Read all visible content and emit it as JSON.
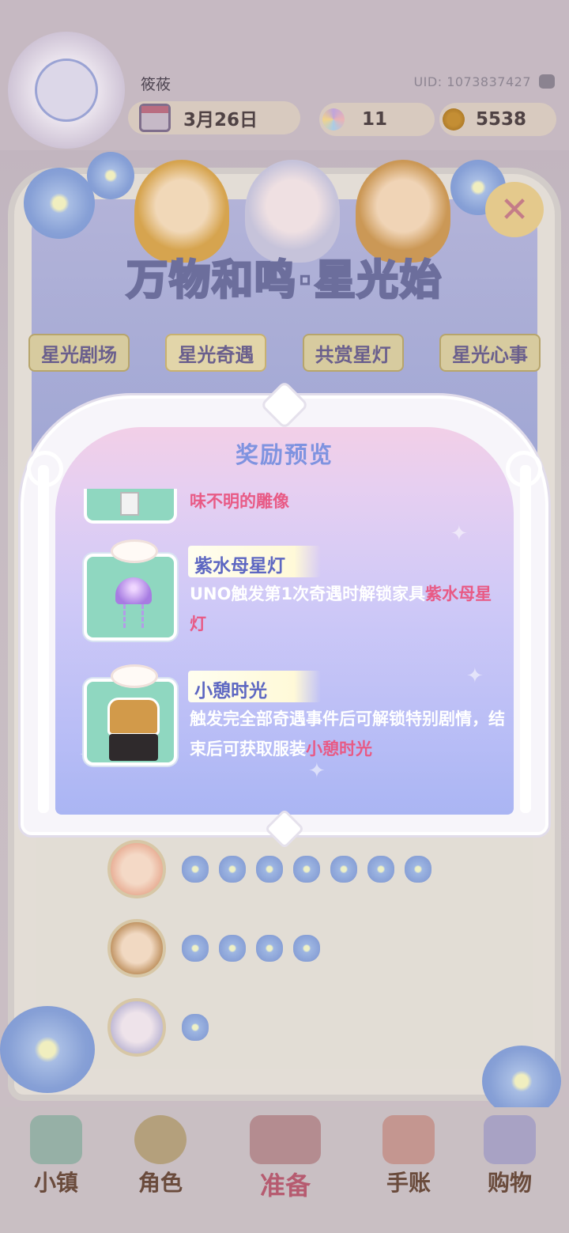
{
  "header": {
    "username": "筱莜",
    "uid": "UID: 1073837427",
    "date": "3月26日",
    "gems": "11",
    "coins": "5538"
  },
  "event": {
    "title": "万物和鸣·星光始",
    "tabs": [
      {
        "label": "星光剧场"
      },
      {
        "label": "星光奇遇"
      },
      {
        "label": "共赏星灯"
      },
      {
        "label": "星光心事"
      }
    ],
    "active_tab": "星光奇遇"
  },
  "modal": {
    "title": "奖励预览",
    "partial_item_text": "味不明的雕像",
    "rewards": [
      {
        "name": "紫水母星灯",
        "desc_plain": "UNO触发第1次奇遇时解锁家具",
        "desc_highlight": "紫水母星灯"
      },
      {
        "name": "小憩时光",
        "desc_plain": "触发完全部奇遇事件后可解锁特别剧情，结束后可获取服装",
        "desc_highlight": "小憩时光"
      }
    ]
  },
  "affinity": {
    "rows": [
      {
        "stars": 7
      },
      {
        "stars": 4
      },
      {
        "stars": 1
      }
    ]
  },
  "nav": {
    "town": "小镇",
    "role": "角色",
    "ready": "准备",
    "diary": "手账",
    "shop": "购物"
  },
  "colors": {
    "accent_pink": "#e85a85",
    "title_blue": "#7f93e0",
    "card_mint": "#8fd7c0"
  }
}
